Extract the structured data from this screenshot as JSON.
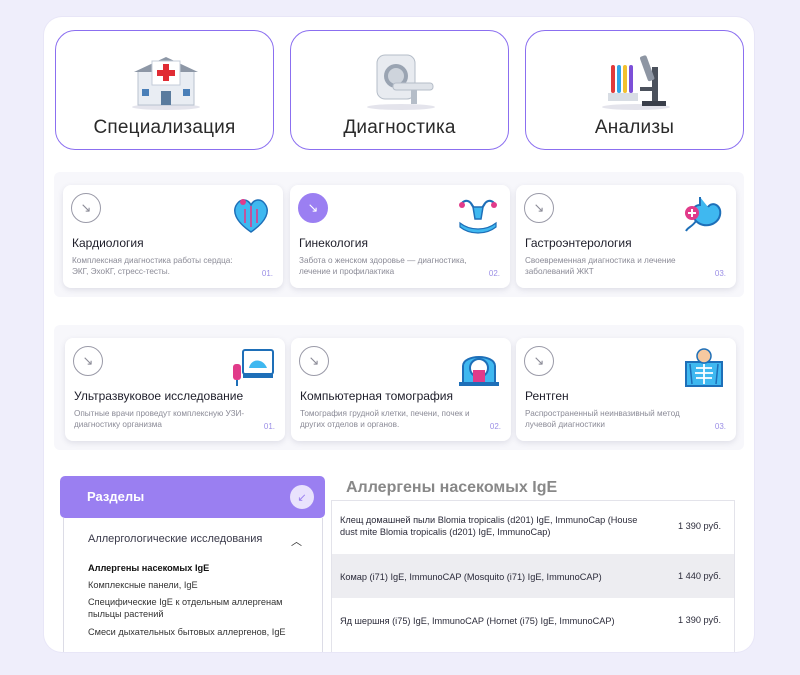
{
  "categories": [
    {
      "label": "Специализация",
      "icon": "hospital-icon"
    },
    {
      "label": "Диагностика",
      "icon": "mri-scanner-icon"
    },
    {
      "label": "Анализы",
      "icon": "microscope-icon"
    }
  ],
  "services_row1": [
    {
      "title": "Кардиология",
      "desc": "Комплексная диагностика работы сердца: ЭКГ, ЭхоКГ, стресс-тесты.",
      "num": "01.",
      "icon": "heart-icon"
    },
    {
      "title": "Гинекология",
      "desc": "Забота о женском здоровье — диагностика, лечение и профилактика",
      "num": "02.",
      "icon": "uterus-icon"
    },
    {
      "title": "Гастроэнтерология",
      "desc": "Своевременная диагностика и лечение заболеваний ЖКТ",
      "num": "03.",
      "icon": "stomach-icon"
    }
  ],
  "services_row2": [
    {
      "title": "Ультразвуковое исследование",
      "desc": "Опытные врачи проведут комплексную УЗИ-диагностику организма",
      "num": "01.",
      "icon": "ultrasound-icon"
    },
    {
      "title": "Компьютерная томография",
      "desc": "Томография грудной клетки, печени, почек и других отделов и органов.",
      "num": "02.",
      "icon": "ct-scanner-icon"
    },
    {
      "title": "Рентген",
      "desc": "Распространенный неинвазивный метод лучевой диагностики",
      "num": "03.",
      "icon": "xray-icon"
    }
  ],
  "sidebar": {
    "title": "Разделы",
    "group": "Аллергологические исследования",
    "items": [
      "Аллергены насекомых IgE",
      "Комплексные панели, IgE",
      "Специфические IgE к отдельным аллергенам пыльцы растений",
      "Смеси дыхательных бытовых аллергенов, IgE"
    ]
  },
  "table": {
    "title": "Аллергены насекомых IgE",
    "rows": [
      {
        "name": "Клещ домашней пыли Blomia tropicalis (d201) IgE, ImmunoCap (House dust mite Blomia tropicalis (d201) IgE, ImmunoCap)",
        "price": "1 390 руб."
      },
      {
        "name": "Комар (i71) IgE, ImmunoCAP (Mosquito (i71) IgE, ImmunoCAP)",
        "price": "1 440 руб."
      },
      {
        "name": "Яд шершня (i75) IgE, ImmunoCAP (Hornet (i75) IgE, ImmunoCAP)",
        "price": "1 390 руб."
      }
    ]
  },
  "colors": {
    "accent": "#9a7ff1",
    "border": "#8b6ff0",
    "row_highlight": "#ededf1"
  }
}
